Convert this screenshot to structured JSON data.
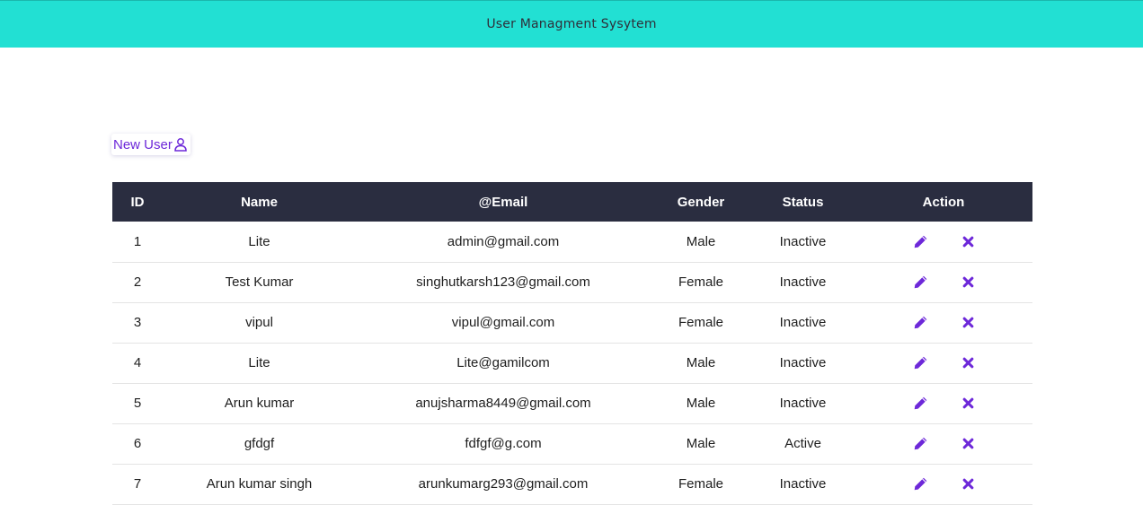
{
  "header": {
    "title": "User Managment Sysytem"
  },
  "toolbar": {
    "new_user_label": "New User"
  },
  "colors": {
    "header_bg": "#22e0d3",
    "table_header_bg": "#2a2d40",
    "accent": "#6d28d9"
  },
  "table": {
    "columns": [
      "ID",
      "Name",
      "@Email",
      "Gender",
      "Status",
      "Action"
    ],
    "rows": [
      {
        "id": "1",
        "name": "Lite",
        "email": "admin@gmail.com",
        "gender": "Male",
        "status": "Inactive"
      },
      {
        "id": "2",
        "name": "Test Kumar",
        "email": "singhutkarsh123@gmail.com",
        "gender": "Female",
        "status": "Inactive"
      },
      {
        "id": "3",
        "name": "vipul",
        "email": "vipul@gmail.com",
        "gender": "Female",
        "status": "Inactive"
      },
      {
        "id": "4",
        "name": "Lite",
        "email": "Lite@gamilcom",
        "gender": "Male",
        "status": "Inactive"
      },
      {
        "id": "5",
        "name": "Arun kumar",
        "email": "anujsharma8449@gmail.com",
        "gender": "Male",
        "status": "Inactive"
      },
      {
        "id": "6",
        "name": "gfdgf",
        "email": "fdfgf@g.com",
        "gender": "Male",
        "status": "Active"
      },
      {
        "id": "7",
        "name": "Arun kumar singh",
        "email": "arunkumarg293@gmail.com",
        "gender": "Female",
        "status": "Inactive"
      }
    ],
    "row_action_icons": [
      "pencil-icon",
      "close-icon"
    ]
  }
}
